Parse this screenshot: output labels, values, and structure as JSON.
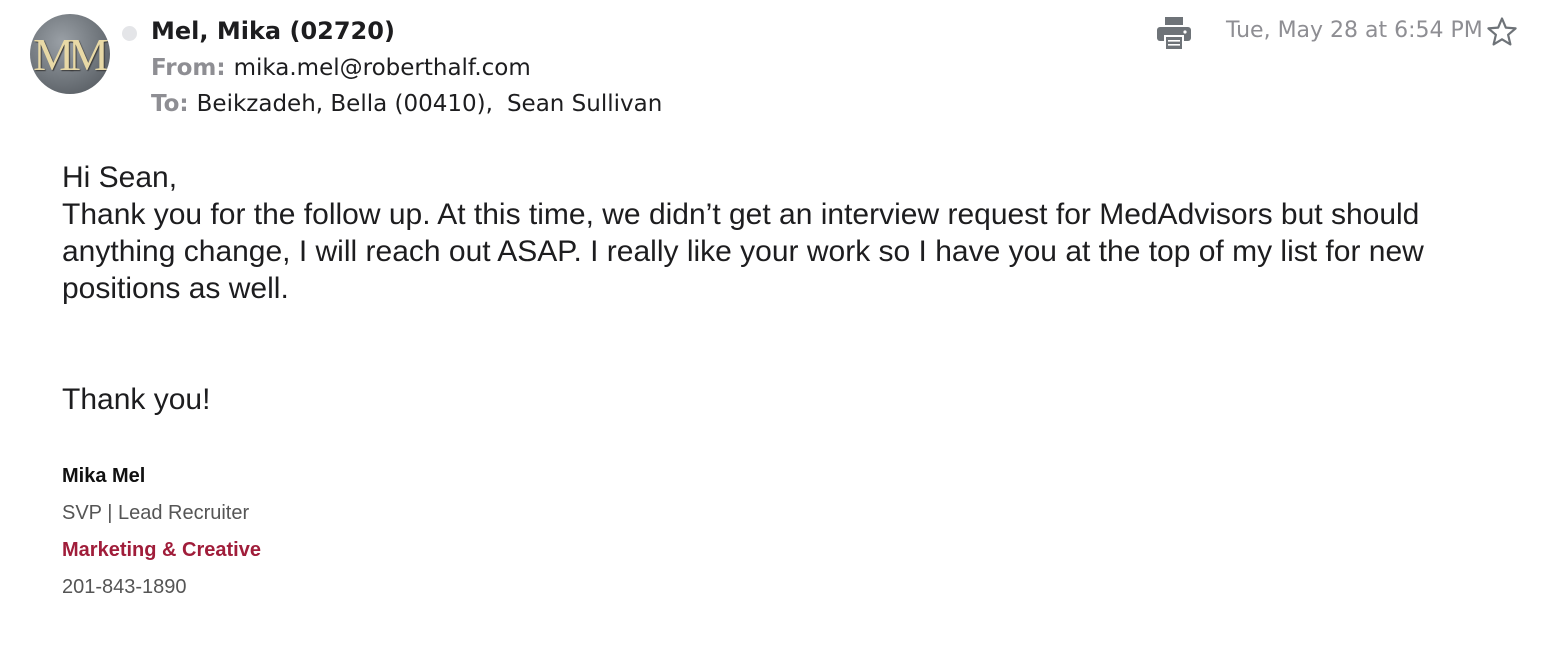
{
  "header": {
    "avatar_initials": "MM",
    "sender_name": "Mel, Mika (02720)",
    "from_label": "From:",
    "from_address": "mika.mel@roberthalf.com",
    "to_label": "To:",
    "recipients": [
      "Beikzadeh, Bella (00410),",
      "Sean Sullivan"
    ],
    "date": "Tue, May 28 at 6:54 PM",
    "print_icon": "printer-icon",
    "star_icon": "star-outline-icon",
    "unread_indicator_color": "#e4e5e8"
  },
  "body": {
    "greeting": "Hi Sean,",
    "paragraph": "Thank you for the follow up.  At this time, we didn’t get an interview request for MedAdvisors but should anything change, I will reach out ASAP.  I really like your work so I have you at the top of my list for new positions as well.",
    "closing": "Thank you!"
  },
  "signature": {
    "name": "Mika Mel",
    "title": "SVP | Lead Recruiter",
    "department": "Marketing & Creative",
    "department_color": "#a01d3a",
    "phone": "201-843-1890"
  }
}
